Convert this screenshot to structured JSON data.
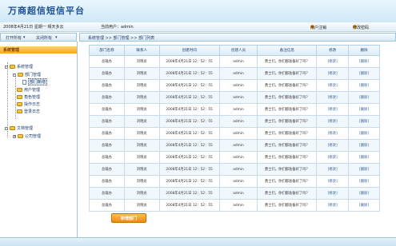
{
  "header": {
    "title": "万商超信短信平台"
  },
  "infobar": {
    "date": "2008年4月21日 星期一 晴天多云",
    "user": "当前用户：admin",
    "logout": "用户注销",
    "change_password": "修改密码"
  },
  "sidebar": {
    "open_all": "打开所有",
    "close_all": "关闭所有",
    "title": "系统管理",
    "tree": {
      "root": "系统管理",
      "dept": "部门管理",
      "dept_add": "部门新增",
      "users": "用户管理",
      "roles": "角色管理",
      "oplog": "操作日志",
      "loginlog": "登录日志",
      "docs": "文档管理",
      "company": "公司管理"
    }
  },
  "breadcrumb": "系统管理  >>  部门管理  >>  部门列表",
  "table": {
    "headers": [
      "部门名称",
      "联系人",
      "创建时间",
      "创建人员",
      "备注信息",
      "修改",
      "删除"
    ],
    "rows": [
      [
        "总裁办",
        "刘晓龙",
        "2008年4月21日 12：52：55",
        "admin",
        "勇士们，你们都准备好了吗？",
        "[修改]",
        "[删除]"
      ],
      [
        "总裁办",
        "刘晓龙",
        "2008年4月21日 12：52：55",
        "admin",
        "勇士们，你们都准备好了吗？",
        "[修改]",
        "[删除]"
      ],
      [
        "总裁办",
        "刘晓龙",
        "2008年4月21日 12：52：55",
        "admin",
        "勇士们，你们都准备好了吗？",
        "[修改]",
        "[删除]"
      ],
      [
        "总裁办",
        "刘晓龙",
        "2008年4月21日 12：52：55",
        "admin",
        "勇士们，你们都准备好了吗？",
        "[修改]",
        "[删除]"
      ],
      [
        "总裁办",
        "刘晓龙",
        "2008年4月21日 12：52：55",
        "admin",
        "勇士们，你们都准备好了吗？",
        "[修改]",
        "[删除]"
      ],
      [
        "总裁办",
        "刘晓龙",
        "2008年4月21日 12：52：55",
        "admin",
        "勇士们，你们都准备好了吗？",
        "[修改]",
        "[删除]"
      ],
      [
        "总裁办",
        "刘晓龙",
        "2008年4月21日 12：52：55",
        "admin",
        "勇士们，你们都准备好了吗？",
        "[修改]",
        "[删除]"
      ],
      [
        "总裁办",
        "刘晓龙",
        "2008年4月21日 12：52：55",
        "admin",
        "勇士们，你们都准备好了吗？",
        "[修改]",
        "[删除]"
      ],
      [
        "总裁办",
        "刘晓龙",
        "2008年4月21日 12：52：55",
        "admin",
        "勇士们，你们都准备好了吗？",
        "[修改]",
        "[删除]"
      ],
      [
        "总裁办",
        "刘晓龙",
        "2008年4月21日 12：52：55",
        "admin",
        "勇士们，你们都准备好了吗？",
        "[修改]",
        "[删除]"
      ],
      [
        "总裁办",
        "刘晓龙",
        "2008年4月21日 12：52：55",
        "admin",
        "勇士们，你们都准备好了吗？",
        "[修改]",
        "[删除]"
      ],
      [
        "总裁办",
        "刘晓龙",
        "2008年4月21日 12：52：55",
        "admin",
        "勇士们，你们都准备好了吗？",
        "[修改]",
        "[删除]"
      ],
      [
        "总裁办",
        "刘晓龙",
        "2008年4月21日 12：52：55",
        "admin",
        "勇士们，你们都准备好了吗？",
        "[修改]",
        "[删除]"
      ]
    ]
  },
  "add_button": "新增部门",
  "colors": {
    "accent": "#f39a1e",
    "header_blue": "#cfe8f7",
    "border": "#9cc4dd"
  }
}
